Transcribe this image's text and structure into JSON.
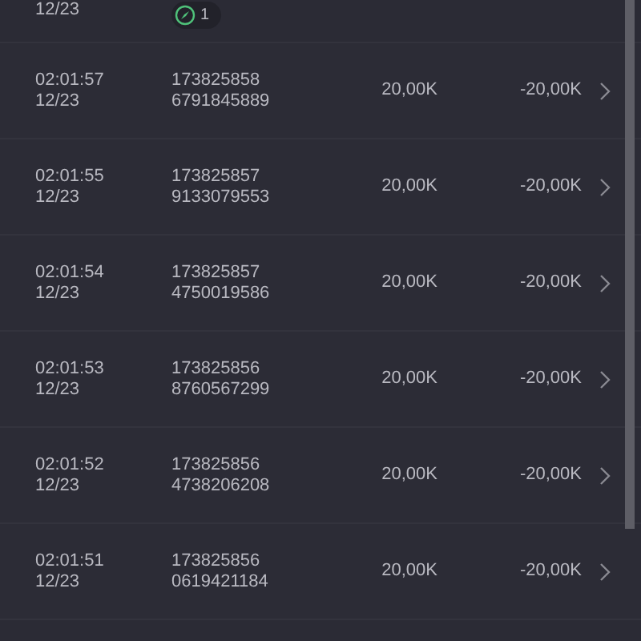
{
  "partial_row": {
    "date": "12/23",
    "badge": "1"
  },
  "rows": [
    {
      "time": "02:01:57",
      "date": "12/23",
      "id_line_1": "173825858",
      "id_line_2": "6791845889",
      "amount": "20,00K",
      "change": "-20,00K"
    },
    {
      "time": "02:01:55",
      "date": "12/23",
      "id_line_1": "173825857",
      "id_line_2": "9133079553",
      "amount": "20,00K",
      "change": "-20,00K"
    },
    {
      "time": "02:01:54",
      "date": "12/23",
      "id_line_1": "173825857",
      "id_line_2": "4750019586",
      "amount": "20,00K",
      "change": "-20,00K"
    },
    {
      "time": "02:01:53",
      "date": "12/23",
      "id_line_1": "173825856",
      "id_line_2": "8760567299",
      "amount": "20,00K",
      "change": "-20,00K"
    },
    {
      "time": "02:01:52",
      "date": "12/23",
      "id_line_1": "173825856",
      "id_line_2": "4738206208",
      "amount": "20,00K",
      "change": "-20,00K"
    },
    {
      "time": "02:01:51",
      "date": "12/23",
      "id_line_1": "173825856",
      "id_line_2": "0619421184",
      "amount": "20,00K",
      "change": "-20,00K"
    }
  ]
}
